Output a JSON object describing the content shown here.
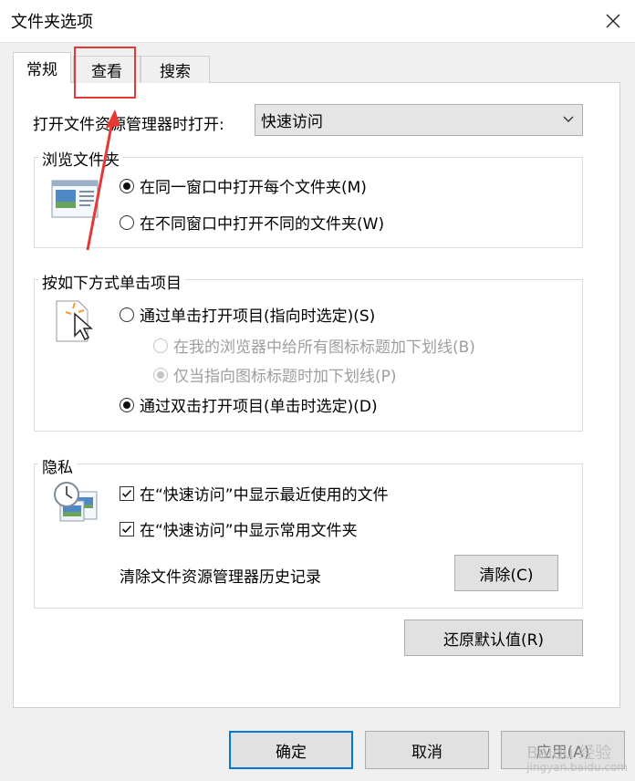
{
  "window": {
    "title": "文件夹选项"
  },
  "tabs": [
    {
      "label": "常规"
    },
    {
      "label": "查看"
    },
    {
      "label": "搜索"
    }
  ],
  "general": {
    "open_label": "打开文件资源管理器时打开:",
    "open_value": "快速访问",
    "browse_group": {
      "label": "浏览文件夹",
      "options": [
        {
          "label": "在同一窗口中打开每个文件夹(M)",
          "selected": true
        },
        {
          "label": "在不同窗口中打开不同的文件夹(W)",
          "selected": false
        }
      ]
    },
    "click_group": {
      "label": "按如下方式单击项目",
      "options": [
        {
          "label": "通过单击打开项目(指向时选定)(S)",
          "selected": false
        },
        {
          "label": "在我的浏览器中给所有图标标题加下划线(B)",
          "selected": false,
          "disabled": true
        },
        {
          "label": "仅当指向图标标题时加下划线(P)",
          "selected": true,
          "disabled": true
        },
        {
          "label": "通过双击打开项目(单击时选定)(D)",
          "selected": true
        }
      ]
    },
    "privacy_group": {
      "label": "隐私",
      "checks": [
        {
          "label": "在“快速访问”中显示最近使用的文件",
          "checked": true
        },
        {
          "label": "在“快速访问”中显示常用文件夹",
          "checked": true
        }
      ],
      "clear_label": "清除文件资源管理器历史记录",
      "clear_button": "清除(C)"
    },
    "restore_button": "还原默认值(R)"
  },
  "footer": {
    "ok": "确定",
    "cancel": "取消",
    "apply": "应用(A)"
  },
  "watermark": {
    "line1": "Baidu 经验",
    "line2": "jingyan.baidu.com"
  },
  "colors": {
    "highlight": "#e53935",
    "primary_border": "#0078d7"
  }
}
